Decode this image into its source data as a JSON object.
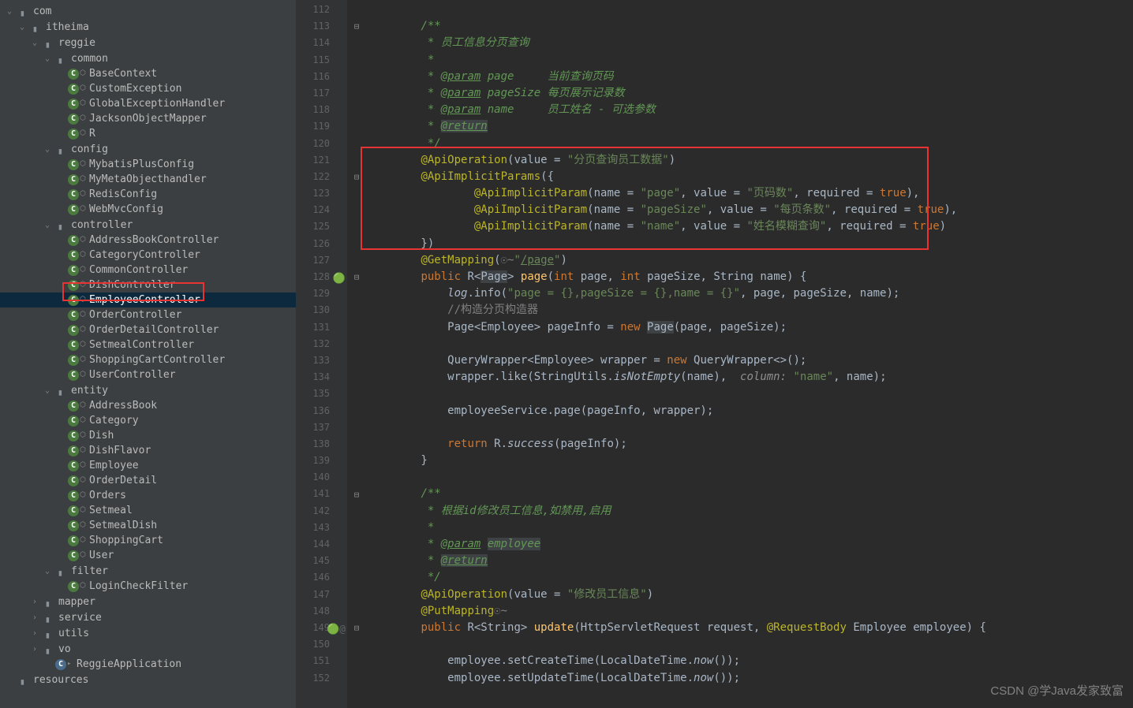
{
  "tree": [
    {
      "indent": 0,
      "arrow": "v",
      "type": "folder",
      "label": "com"
    },
    {
      "indent": 1,
      "arrow": "v",
      "type": "folder",
      "label": "itheima"
    },
    {
      "indent": 2,
      "arrow": "v",
      "type": "folder",
      "label": "reggie"
    },
    {
      "indent": 3,
      "arrow": "v",
      "type": "folder",
      "label": "common"
    },
    {
      "indent": 4,
      "arrow": "",
      "type": "class",
      "label": "BaseContext"
    },
    {
      "indent": 4,
      "arrow": "",
      "type": "class",
      "label": "CustomException"
    },
    {
      "indent": 4,
      "arrow": "",
      "type": "class",
      "label": "GlobalExceptionHandler"
    },
    {
      "indent": 4,
      "arrow": "",
      "type": "class",
      "label": "JacksonObjectMapper"
    },
    {
      "indent": 4,
      "arrow": "",
      "type": "class",
      "label": "R"
    },
    {
      "indent": 3,
      "arrow": "v",
      "type": "folder",
      "label": "config"
    },
    {
      "indent": 4,
      "arrow": "",
      "type": "class",
      "label": "MybatisPlusConfig"
    },
    {
      "indent": 4,
      "arrow": "",
      "type": "class",
      "label": "MyMetaObjecthandler"
    },
    {
      "indent": 4,
      "arrow": "",
      "type": "class",
      "label": "RedisConfig"
    },
    {
      "indent": 4,
      "arrow": "",
      "type": "class",
      "label": "WebMvcConfig"
    },
    {
      "indent": 3,
      "arrow": "v",
      "type": "folder",
      "label": "controller"
    },
    {
      "indent": 4,
      "arrow": "",
      "type": "class",
      "label": "AddressBookController"
    },
    {
      "indent": 4,
      "arrow": "",
      "type": "class",
      "label": "CategoryController"
    },
    {
      "indent": 4,
      "arrow": "",
      "type": "class",
      "label": "CommonController"
    },
    {
      "indent": 4,
      "arrow": "",
      "type": "class",
      "label": "DishController"
    },
    {
      "indent": 4,
      "arrow": "",
      "type": "class",
      "label": "EmployeeController",
      "selected": true
    },
    {
      "indent": 4,
      "arrow": "",
      "type": "class",
      "label": "OrderController"
    },
    {
      "indent": 4,
      "arrow": "",
      "type": "class",
      "label": "OrderDetailController"
    },
    {
      "indent": 4,
      "arrow": "",
      "type": "class",
      "label": "SetmealController"
    },
    {
      "indent": 4,
      "arrow": "",
      "type": "class",
      "label": "ShoppingCartController"
    },
    {
      "indent": 4,
      "arrow": "",
      "type": "class",
      "label": "UserController"
    },
    {
      "indent": 3,
      "arrow": "v",
      "type": "folder",
      "label": "entity"
    },
    {
      "indent": 4,
      "arrow": "",
      "type": "class",
      "label": "AddressBook"
    },
    {
      "indent": 4,
      "arrow": "",
      "type": "class",
      "label": "Category"
    },
    {
      "indent": 4,
      "arrow": "",
      "type": "class",
      "label": "Dish"
    },
    {
      "indent": 4,
      "arrow": "",
      "type": "class",
      "label": "DishFlavor"
    },
    {
      "indent": 4,
      "arrow": "",
      "type": "class",
      "label": "Employee"
    },
    {
      "indent": 4,
      "arrow": "",
      "type": "class",
      "label": "OrderDetail"
    },
    {
      "indent": 4,
      "arrow": "",
      "type": "class",
      "label": "Orders"
    },
    {
      "indent": 4,
      "arrow": "",
      "type": "class",
      "label": "Setmeal"
    },
    {
      "indent": 4,
      "arrow": "",
      "type": "class",
      "label": "SetmealDish"
    },
    {
      "indent": 4,
      "arrow": "",
      "type": "class",
      "label": "ShoppingCart"
    },
    {
      "indent": 4,
      "arrow": "",
      "type": "class",
      "label": "User"
    },
    {
      "indent": 3,
      "arrow": "v",
      "type": "folder",
      "label": "filter"
    },
    {
      "indent": 4,
      "arrow": "",
      "type": "class",
      "label": "LoginCheckFilter"
    },
    {
      "indent": 2,
      "arrow": ">",
      "type": "folder",
      "label": "mapper"
    },
    {
      "indent": 2,
      "arrow": ">",
      "type": "folder",
      "label": "service"
    },
    {
      "indent": 2,
      "arrow": ">",
      "type": "folder",
      "label": "utils"
    },
    {
      "indent": 2,
      "arrow": ">",
      "type": "folder",
      "label": "vo"
    },
    {
      "indent": 3,
      "arrow": "",
      "type": "class-blue",
      "label": "ReggieApplication"
    },
    {
      "indent": 0,
      "arrow": "",
      "type": "folder",
      "label": "resources"
    }
  ],
  "lineStart": 112,
  "lines": [
    {
      "html": ""
    },
    {
      "html": "        <span class='c-comment-it'>/**</span>",
      "fold": "-"
    },
    {
      "html": "        <span class='c-comment-it'> * 员工信息分页查询</span>"
    },
    {
      "html": "        <span class='c-comment-it'> *</span>"
    },
    {
      "html": "        <span class='c-comment-it'> * <span class='c-tag-u'>@param</span> page     当前查询页码</span>"
    },
    {
      "html": "        <span class='c-comment-it'> * <span class='c-tag-u'>@param</span> pageSize 每页展示记录数</span>"
    },
    {
      "html": "        <span class='c-comment-it'> * <span class='c-tag-u'>@param</span> name     员工姓名 - 可选参数</span>"
    },
    {
      "html": "        <span class='c-comment-it'> * <span class='c-tag-u c-hl'>@return</span></span>"
    },
    {
      "html": "        <span class='c-comment-it'> */</span>"
    },
    {
      "html": "        <span class='c-ann'>@ApiOperation</span>(value = <span class='c-str'>\"分页查询员工数据\"</span>)"
    },
    {
      "html": "        <span class='c-ann'>@ApiImplicitParams</span>({",
      "fold": "-"
    },
    {
      "html": "                <span class='c-ann'>@ApiImplicitParam</span>(name = <span class='c-str'>\"page\"</span>, value = <span class='c-str'>\"页码数\"</span>, required = <span class='c-kw'>true</span>),"
    },
    {
      "html": "                <span class='c-ann'>@ApiImplicitParam</span>(name = <span class='c-str'>\"pageSize\"</span>, value = <span class='c-str'>\"每页条数\"</span>, required = <span class='c-kw'>true</span>),"
    },
    {
      "html": "                <span class='c-ann'>@ApiImplicitParam</span>(name = <span class='c-str'>\"name\"</span>, value = <span class='c-str'>\"姓名模糊查询\"</span>, required = <span class='c-kw'>true</span>)"
    },
    {
      "html": "        })"
    },
    {
      "html": "        <span class='c-ann'>@GetMapping</span>(<span class='c-comment'>☉~</span><span class='c-str'>\"<span class='c-tag-u'>/page</span>\"</span>)"
    },
    {
      "html": "        <span class='c-kw'>public</span> R&lt;<span class='c-hl'>Page</span>&gt; <span class='c-method'>page</span>(<span class='c-kw'>int</span> page, <span class='c-kw'>int</span> pageSize, String name) {",
      "fold": "-",
      "gmark": "🟢"
    },
    {
      "html": "            <span class='c-ital'>log</span>.info(<span class='c-str'>\"page = {},pageSize = {},name = {}\"</span>, page, pageSize, name);"
    },
    {
      "html": "            <span class='c-comment'>//构造分页构造器</span>"
    },
    {
      "html": "            Page&lt;Employee&gt; pageInfo = <span class='c-kw'>new</span> <span class='c-hl'>Page</span>(page, pageSize);"
    },
    {
      "html": ""
    },
    {
      "html": "            QueryWrapper&lt;Employee&gt; wrapper = <span class='c-kw'>new</span> QueryWrapper&lt;&gt;();"
    },
    {
      "html": "            wrapper.like(StringUtils.<span class='c-ital'>isNotEmpty</span>(name),  <span class='c-paramname'>column:</span> <span class='c-str'>\"name\"</span>, name);"
    },
    {
      "html": ""
    },
    {
      "html": "            employeeService.page(pageInfo, wrapper);"
    },
    {
      "html": ""
    },
    {
      "html": "            <span class='c-kw'>return</span> R.<span class='c-ital'>success</span>(pageInfo);"
    },
    {
      "html": "        }"
    },
    {
      "html": ""
    },
    {
      "html": "        <span class='c-comment-it'>/**</span>",
      "fold": "-"
    },
    {
      "html": "        <span class='c-comment-it'> * 根据id修改员工信息,如禁用,启用</span>"
    },
    {
      "html": "        <span class='c-comment-it'> *</span>"
    },
    {
      "html": "        <span class='c-comment-it'> * <span class='c-tag-u'>@param</span> <span class='c-hl'>employee</span></span>"
    },
    {
      "html": "        <span class='c-comment-it'> * <span class='c-tag-u c-hl'>@return</span></span>"
    },
    {
      "html": "        <span class='c-comment-it'> */</span>"
    },
    {
      "html": "        <span class='c-ann'>@ApiOperation</span>(value = <span class='c-str'>\"修改员工信息\"</span>)"
    },
    {
      "html": "        <span class='c-ann'>@PutMapping</span><span class='c-comment'>☉~</span>"
    },
    {
      "html": "        <span class='c-kw'>public</span> R&lt;String&gt; <span class='c-method'>update</span>(HttpServletRequest request, <span class='c-ann'>@RequestBody</span> Employee employee) {",
      "fold": "-",
      "gmark": "🟢@"
    },
    {
      "html": ""
    },
    {
      "html": "            employee.setCreateTime(LocalDateTime.<span class='c-ital'>now</span>());"
    },
    {
      "html": "            employee.setUpdateTime(LocalDateTime.<span class='c-ital'>now</span>());"
    }
  ],
  "watermark": "CSDN @学Java发家致富"
}
